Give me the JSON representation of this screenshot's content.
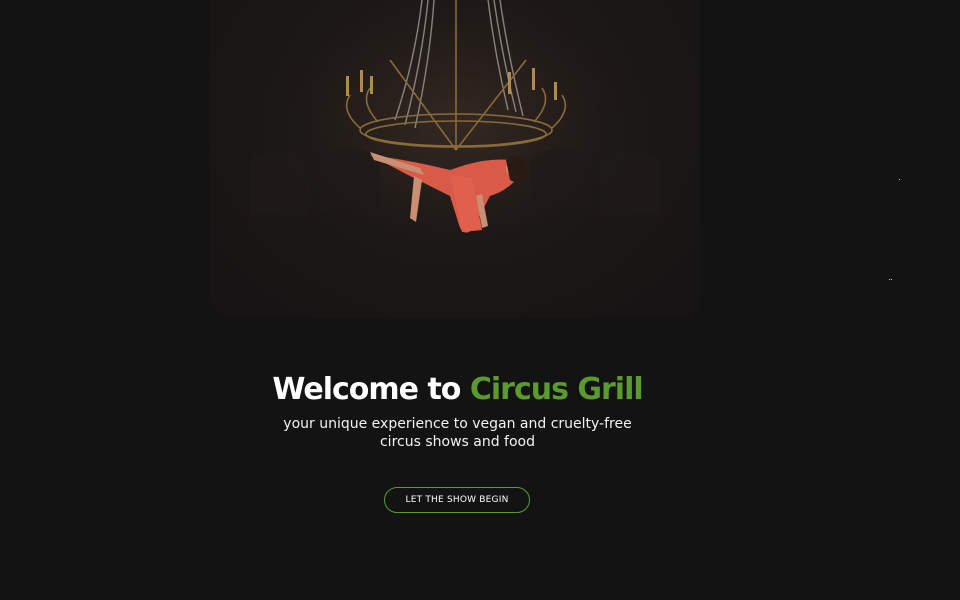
{
  "hero": {
    "title_prefix": "Welcome to",
    "title_brand": "Circus Grill",
    "tagline_line1": "your unique experience to vegan and cruelty-free",
    "tagline_line2": "circus shows and food",
    "cta_label": "LET THE SHOW BEGIN"
  },
  "image": {
    "subject": "aerial performer in red dress on suspended chandelier"
  },
  "colors": {
    "background": "#141314",
    "brand_green": "#5a9a2f",
    "text": "#ffffff"
  }
}
